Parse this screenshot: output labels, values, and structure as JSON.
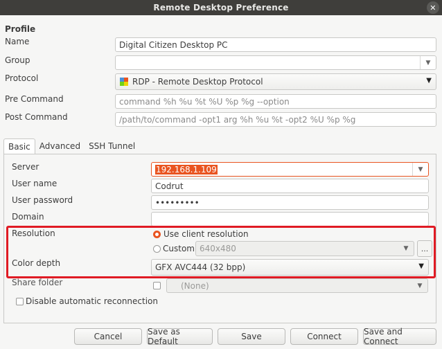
{
  "window": {
    "title": "Remote Desktop Preference"
  },
  "profile": {
    "heading": "Profile",
    "name_label": "Name",
    "name_value": "Digital Citizen Desktop PC",
    "group_label": "Group",
    "group_value": "",
    "protocol_label": "Protocol",
    "protocol_value": "RDP - Remote Desktop Protocol",
    "pre_command_label": "Pre Command",
    "pre_command_placeholder": "command %h %u %t %U %p %g --option",
    "post_command_label": "Post Command",
    "post_command_placeholder": "/path/to/command -opt1 arg %h %u %t -opt2 %U %p %g"
  },
  "tabs": [
    {
      "label": "Basic",
      "active": true
    },
    {
      "label": "Advanced",
      "active": false
    },
    {
      "label": "SSH Tunnel",
      "active": false
    }
  ],
  "basic": {
    "server_label": "Server",
    "server_value": "192.168.1.109",
    "username_label": "User name",
    "username_value": "Codrut",
    "password_label": "User password",
    "password_value": "•••••••••",
    "domain_label": "Domain",
    "domain_value": "",
    "resolution_label": "Resolution",
    "resolution_option_client": "Use client resolution",
    "resolution_option_custom": "Custom",
    "custom_resolution_value": "640x480",
    "custom_more": "...",
    "color_depth_label": "Color depth",
    "color_depth_value": "GFX AVC444 (32 bpp)",
    "share_folder_label": "Share folder",
    "share_folder_value": "(None)",
    "disable_reconnect_label": "Disable automatic reconnection"
  },
  "buttons": {
    "cancel": "Cancel",
    "save_default": "Save as Default",
    "save": "Save",
    "connect": "Connect",
    "save_connect": "Save and Connect"
  },
  "colors": {
    "accent": "#e95420",
    "highlight_box": "#e01b24",
    "titlebar": "#3f3e3b"
  }
}
